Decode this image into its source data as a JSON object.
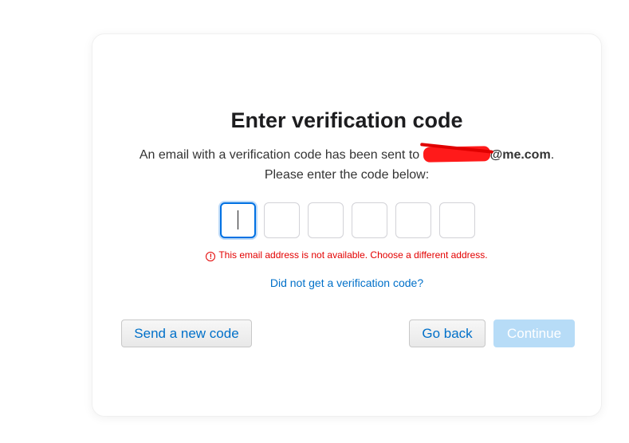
{
  "dialog": {
    "title": "Enter verification code",
    "description_prefix": "An email with a verification code has been sent to ",
    "email_suffix": "@me.com",
    "description_period": ".",
    "description_line2": "Please enter the code below:",
    "code_digits": [
      "",
      "",
      "",
      "",
      "",
      ""
    ],
    "error_icon": "alert-circle-icon",
    "error_message": "This email address is not available. Choose a different address.",
    "resend_link": "Did not get a verification code?",
    "buttons": {
      "send_new_code": "Send a new code",
      "go_back": "Go back",
      "continue": "Continue"
    },
    "colors": {
      "accent": "#0070c9",
      "error": "#e30000",
      "disabled_button": "#b7dcf7"
    }
  }
}
